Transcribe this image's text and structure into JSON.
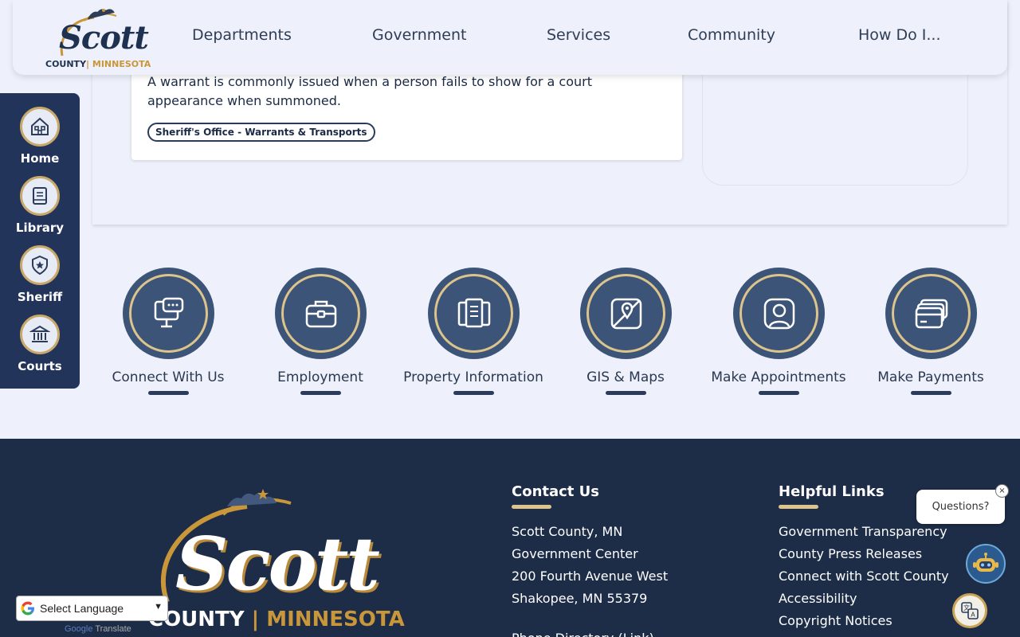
{
  "header": {
    "logo_word": "Scott",
    "logo_county": "COUNTY",
    "logo_state": "MINNESOTA",
    "nav": [
      "Departments",
      "Government",
      "Services",
      "Community",
      "How Do I..."
    ]
  },
  "card": {
    "text": "A warrant is commonly issued when a person fails to show for a court appearance when summoned.",
    "tag": "Sheriff's Office - Warrants & Transports"
  },
  "sidebar": {
    "items": [
      {
        "label": "Home",
        "icon": "home-icon"
      },
      {
        "label": "Library",
        "icon": "book-icon"
      },
      {
        "label": "Sheriff",
        "icon": "badge-icon"
      },
      {
        "label": "Courts",
        "icon": "courthouse-icon"
      }
    ]
  },
  "quick_links": [
    {
      "label": "Connect With Us",
      "icon": "chat-monitor-icon"
    },
    {
      "label": "Employment",
      "icon": "briefcase-icon"
    },
    {
      "label": "Property Information",
      "icon": "documents-icon"
    },
    {
      "label": "GIS & Maps",
      "icon": "map-pin-icon"
    },
    {
      "label": "Make Appointments",
      "icon": "person-icon"
    },
    {
      "label": "Make Payments",
      "icon": "credit-card-icon"
    }
  ],
  "footer": {
    "logo_word": "Scott",
    "logo_county": "COUNTY",
    "logo_state": "MINNESOTA",
    "contact_heading": "Contact Us",
    "contact_lines": [
      "Scott County, MN",
      "Government Center",
      "200 Fourth Avenue West",
      "Shakopee, MN 55379"
    ],
    "contact_more": "Phone Directory (Link)",
    "links_heading": "Helpful Links",
    "links": [
      "Government Transparency",
      "County Press Releases",
      "Connect with Scott County",
      "Accessibility",
      "Copyright Notices"
    ]
  },
  "widgets": {
    "questions": "Questions?",
    "close": "×",
    "language_select": "Select Language",
    "powered_google": "Google",
    "powered_translate": "Translate"
  },
  "colors": {
    "navy": "#1d2c47",
    "gold": "#c9963a",
    "accent_ring": "#dcc48c",
    "icon_navy": "#3c5478"
  }
}
